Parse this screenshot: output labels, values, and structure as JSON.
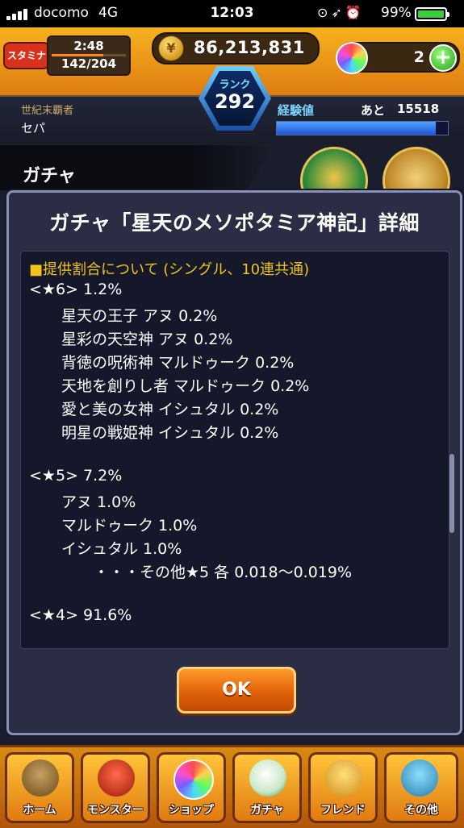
{
  "status_bar": {
    "carrier": "docomo",
    "network": "4G",
    "time": "12:03",
    "battery_percent": "99%"
  },
  "header": {
    "stamina_label": "スタミナ",
    "stamina_timer": "2:48",
    "stamina_value": "142/204",
    "stamina_fraction": 0.696,
    "coins": "86,213,831",
    "orbs": "2",
    "orb_add_label": "+",
    "rank_label": "ランク",
    "rank_value": "292",
    "player_title": "世紀末覇者",
    "player_name": "セパ",
    "exp_label": "経験値",
    "exp_remaining_label": "あと",
    "exp_remaining": "15518",
    "exp_fraction": 0.93
  },
  "page": {
    "title": "ガチャ"
  },
  "dialog": {
    "title": "ガチャ「星天のメソポタミア神記」詳細",
    "section_header": "■提供割合について (シングル、10連共通)",
    "lines": [
      "<★6> 1.2%",
      "星天の王子 アヌ 0.2%",
      "星彩の天空神 アヌ 0.2%",
      "背徳の呪術神 マルドゥーク 0.2%",
      "天地を創りし者 マルドゥーク 0.2%",
      "愛と美の女神 イシュタル 0.2%",
      "明星の戦姫神 イシュタル 0.2%",
      "<★5> 7.2%",
      "アヌ 1.0%",
      "マルドゥーク 1.0%",
      "イシュタル 1.0%",
      "・・・その他★5 各 0.018〜0.019%",
      "<★4> 91.6%"
    ],
    "ok_label": "OK"
  },
  "bottom_nav": {
    "items": [
      {
        "label": "ホーム",
        "icon": "home-icon"
      },
      {
        "label": "モンスター",
        "icon": "monster-icon"
      },
      {
        "label": "ショップ",
        "icon": "shop-orb-icon"
      },
      {
        "label": "ガチャ",
        "icon": "gacha-egg-icon"
      },
      {
        "label": "フレンド",
        "icon": "friend-icon"
      },
      {
        "label": "その他",
        "icon": "other-icon"
      }
    ]
  }
}
